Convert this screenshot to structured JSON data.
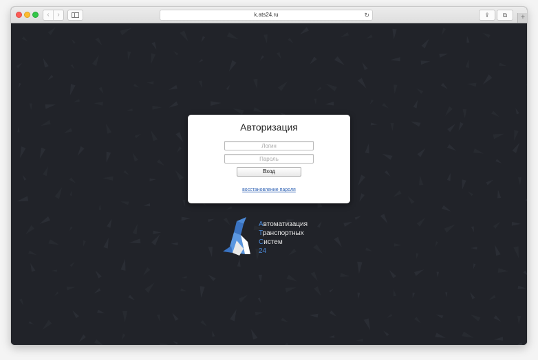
{
  "browser": {
    "url": "k.ats24.ru",
    "back_icon": "‹",
    "forward_icon": "›",
    "reload_icon": "↻",
    "share_icon": "⇪",
    "tabs_icon": "⧉",
    "newtab_icon": "+"
  },
  "auth": {
    "title": "Авторизация",
    "login_placeholder": "Логин",
    "password_placeholder": "Пароль",
    "submit_label": "Вход",
    "recover_link": "восстановление пароля"
  },
  "logo": {
    "lines": [
      {
        "first": "А",
        "rest": "втоматизация"
      },
      {
        "first": "Т",
        "rest": "ранспортных"
      },
      {
        "first": "С",
        "rest": "истем"
      },
      {
        "first": "",
        "rest": "24"
      }
    ]
  },
  "colors": {
    "page_background": "#212329",
    "accent": "#4c8ad8",
    "link": "#2f62b4"
  }
}
